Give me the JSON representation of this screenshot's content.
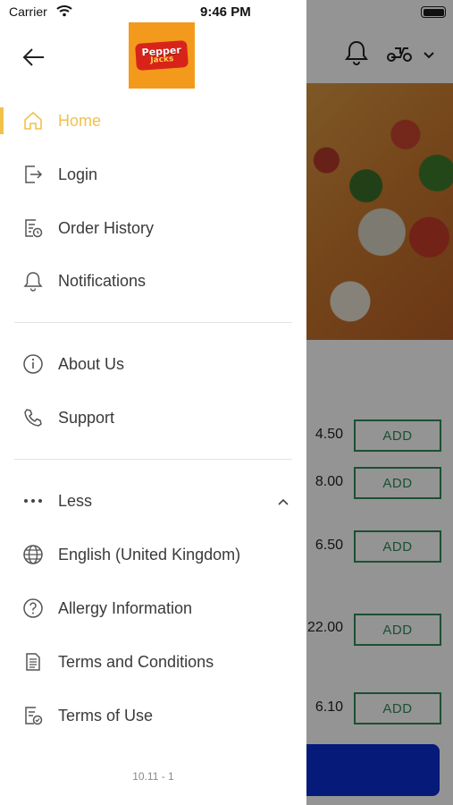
{
  "status_bar": {
    "carrier": "Carrier",
    "time": "9:46 PM"
  },
  "logo": {
    "line1": "Pepper",
    "line2": "Jacks"
  },
  "menu": {
    "home": "Home",
    "login": "Login",
    "order_history": "Order History",
    "notifications": "Notifications",
    "about_us": "About Us",
    "support": "Support",
    "less": "Less",
    "language": "English (United Kingdom)",
    "allergy": "Allergy Information",
    "terms_conditions": "Terms and Conditions",
    "terms_use": "Terms of Use"
  },
  "version": "10.11 - 1",
  "background": {
    "add_label": "ADD",
    "prices": [
      "4.50",
      "8.00",
      "6.50",
      "22.00",
      "6.10"
    ]
  },
  "colors": {
    "accent": "#f2c14a",
    "add_green": "#2f8a5a",
    "cta_blue": "#0b2ed1"
  }
}
